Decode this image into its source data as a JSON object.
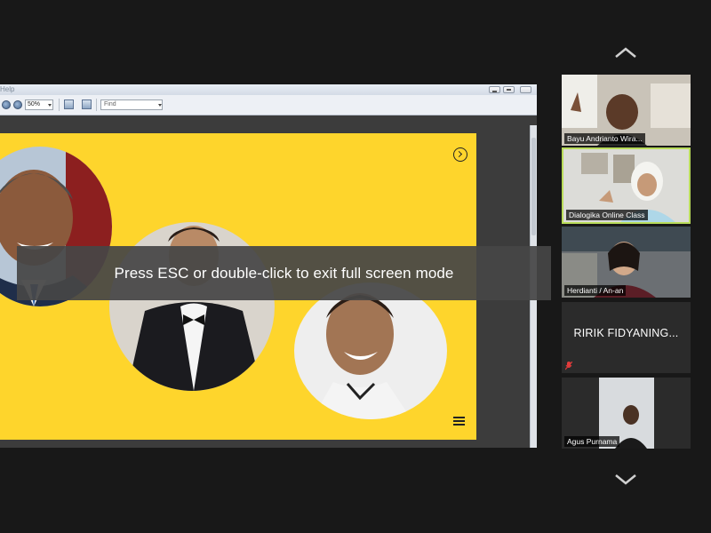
{
  "share_window": {
    "menu_text": "Help",
    "toolbar": {
      "zoom_value": "50%",
      "find_placeholder": "Find"
    }
  },
  "slide": {
    "icons": [
      "chevron-right-circle-icon",
      "hamburger-menu-icon"
    ]
  },
  "toast": {
    "message": "Press ESC or double-click to exit full screen mode"
  },
  "participants": [
    {
      "name": "Bayu Andrianto Wira...",
      "video": true
    },
    {
      "name": "Dialogika Online Class",
      "video": true,
      "active_speaker": true
    },
    {
      "name": "Herdianti / An-an",
      "video": true
    },
    {
      "display_name": "RIRIK FIDYANING...",
      "video": false,
      "muted": true
    },
    {
      "name": "Agus Purnama",
      "video": true
    }
  ],
  "colors": {
    "slide_bg": "#fed52c",
    "active_border": "#b9dc5a",
    "meeting_bg": "#181818"
  }
}
